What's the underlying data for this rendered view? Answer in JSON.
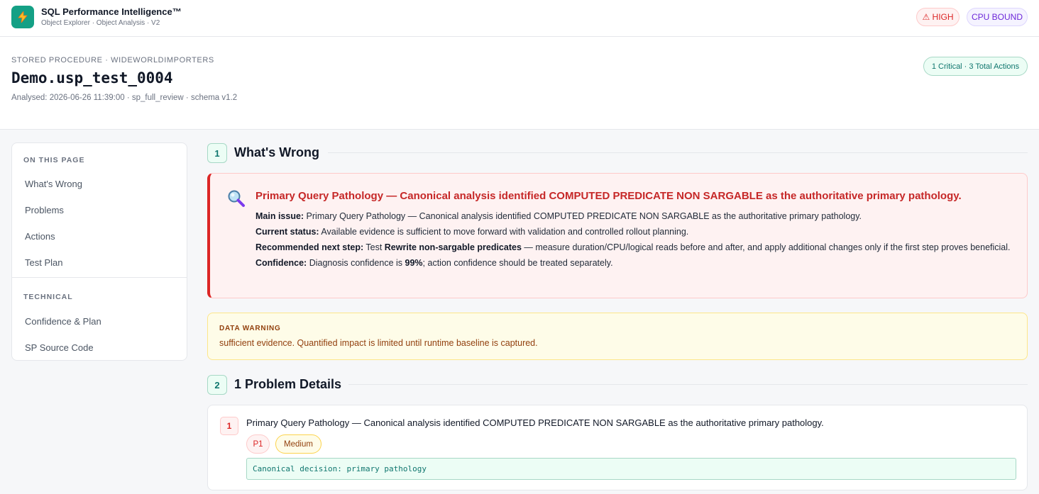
{
  "app": {
    "title": "SQL Performance Intelligence™",
    "subtitle": "Object Explorer · Object Analysis · V2",
    "badges": {
      "severity": "⚠ HIGH",
      "bound": "CPU BOUND"
    }
  },
  "header": {
    "kicker": "STORED PROCEDURE · WIDEWORLDIMPORTERS",
    "object_name": "Demo.usp_test_0004",
    "meta": "Analysed: 2026-06-26 11:39:00 · sp_full_review · schema v1.2",
    "actions_summary": "1 Critical · 3 Total Actions"
  },
  "sidebar": {
    "heading_page": "ON THIS PAGE",
    "page_items": [
      "What's Wrong",
      "Problems",
      "Actions",
      "Test Plan"
    ],
    "heading_technical": "TECHNICAL",
    "technical_items": [
      "Confidence & Plan",
      "SP Source Code"
    ]
  },
  "sections": {
    "wrong": {
      "number": "1",
      "title": "What's Wrong"
    },
    "problems": {
      "number": "2",
      "title": "1 Problem Details"
    }
  },
  "issue": {
    "icon": "magnifier-icon",
    "title": "Primary Query Pathology — Canonical analysis identified COMPUTED PREDICATE NON SARGABLE as the authoritative primary pathology.",
    "main_label": "Main issue:",
    "main_text": " Primary Query Pathology — Canonical analysis identified COMPUTED PREDICATE NON SARGABLE as the authoritative primary pathology.",
    "status_label": "Current status:",
    "status_text": " Available evidence is sufficient to move forward with validation and controlled rollout planning.",
    "next_label": "Recommended next step:",
    "next_pre": " Test ",
    "next_action": "Rewrite non-sargable predicates",
    "next_post": " — measure duration/CPU/logical reads before and after, and apply additional changes only if the first step proves beneficial.",
    "confidence_label": "Confidence:",
    "confidence_pre": " Diagnosis confidence is ",
    "confidence_value": "99%",
    "confidence_post": "; action confidence should be treated separately."
  },
  "warning": {
    "label": "DATA WARNING",
    "text": "sufficient evidence. Quantified impact is limited until runtime baseline is captured."
  },
  "problem": {
    "number": "1",
    "title": "Primary Query Pathology — Canonical analysis identified COMPUTED PREDICATE NON SARGABLE as the authoritative primary pathology.",
    "priority": "P1",
    "severity": "Medium",
    "decision": "Canonical decision: primary pathology"
  },
  "colors": {
    "brand": "#14a085",
    "critical": "#dc2626",
    "warning": "#92400e",
    "accent_bg": "#ecfdf5"
  }
}
